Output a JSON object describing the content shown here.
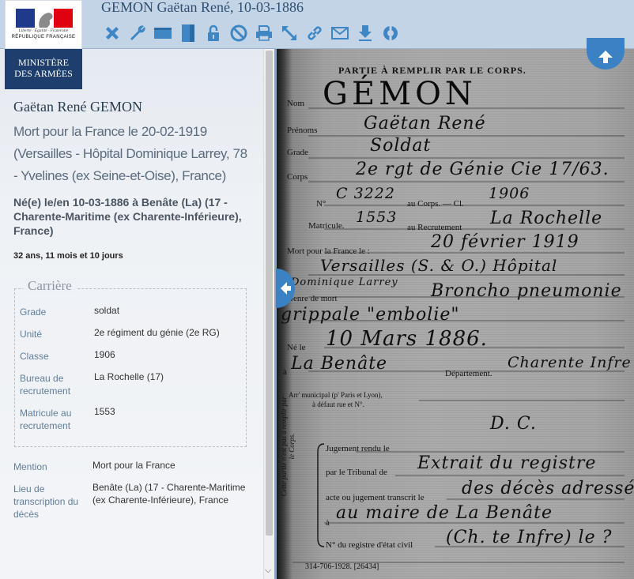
{
  "header": {
    "title": "GEMON Gaëtan René, 10-03-1886"
  },
  "logo": {
    "devise": "Liberté · Égalité · Fraternité",
    "republique": "RÉPUBLIQUE FRANÇAISE",
    "ministere_line1": "MINISTÈRE",
    "ministere_line2": "DES ARMÉES"
  },
  "toolbar": [
    {
      "icon": "close-icon"
    },
    {
      "icon": "wrench-icon"
    },
    {
      "icon": "fit-width-icon"
    },
    {
      "icon": "fit-height-icon"
    },
    {
      "icon": "lock-icon"
    },
    {
      "icon": "forbidden-icon"
    },
    {
      "icon": "print-icon"
    },
    {
      "icon": "resize-icon"
    },
    {
      "icon": "link-icon"
    },
    {
      "icon": "mail-icon"
    },
    {
      "icon": "download-icon"
    },
    {
      "icon": "lifebuoy-icon"
    }
  ],
  "person": {
    "name": "Gaëtan René GEMON",
    "death": "Mort pour la France le 20-02-1919 (Versailles - Hôpital Dominique Larrey, 78 - Yvelines (ex Seine-et-Oise), France)",
    "birth": "Né(e) le/en 10-03-1886 à Benâte (La) (17 - Charente-Maritime (ex Charente-Inférieure), France)",
    "age": "32 ans, 11 mois et 10 jours"
  },
  "career": {
    "legend": "Carrière",
    "rows": [
      {
        "label": "Grade",
        "value": "soldat"
      },
      {
        "label": "Unité",
        "value": "2e régiment du génie (2e RG)"
      },
      {
        "label": "Classe",
        "value": "1906"
      },
      {
        "label": "Bureau de recrutement",
        "value": "La Rochelle (17)"
      },
      {
        "label": "Matricule au recrutement",
        "value": "1553"
      }
    ]
  },
  "mention": {
    "label": "Mention",
    "value": "Mort pour la France"
  },
  "lieu": {
    "label": "Lieu de transcription du décès",
    "value": "Benâte (La) (17 - Charente-Maritime (ex Charente-Inférieure), France"
  },
  "document": {
    "heading": "PARTIE À REMPLIR PAR LE CORPS.",
    "printed": {
      "nom": "Nom",
      "prenoms": "Prénoms",
      "grade": "Grade",
      "corps": "Corps",
      "no": "N°",
      "au_corps": "au Corps. — Cl.",
      "matricule": "Matricule.",
      "au_recrutement": "au Recrutement",
      "mort_pour": "Mort pour la France le :",
      "genre_mort": "Genre de mort",
      "ne_le": "Né le",
      "a": "à",
      "departement": "Département.",
      "arr1": "Arr' municipal (p' Paris et Lyon),",
      "arr2": "à défaut rue et N°.",
      "jugement": "Jugement rendu le",
      "tribunal": "par le Tribunal de",
      "acte": "acte ou jugement transcrit le",
      "a2": "à",
      "registre": "N° du registre d'état civil",
      "footer": "314-706-1928. [26434]",
      "vertical": "Cette partie n'est pas à remplir par le Corps."
    },
    "handwritten": {
      "nom": "GÉMON",
      "prenoms": "Gaëtan René",
      "grade": "Soldat",
      "corps": "2e rgt de Génie Cie 17/63.",
      "no": "C 3222",
      "classe": "1906",
      "matricule": "1553",
      "recrutement": "La Rochelle",
      "date_mort": "20 février 1919",
      "lieu_mort_1": "Versailles (S. & O.) Hôpital",
      "lieu_mort_2": "Dominique Larrey",
      "genre_1": "Broncho pneumonie",
      "genre_2": "grippale \"embolie\"",
      "date_naissance": "10 Mars 1886.",
      "lieu_naissance": "La Benâte",
      "departement": "Charente Infre",
      "dc": "D. C.",
      "tribunal": "Extrait du registre",
      "acte": "des décès adressé",
      "a2": "au maire de La Benâte",
      "registre": "(Ch. te Infre) le ?"
    }
  }
}
